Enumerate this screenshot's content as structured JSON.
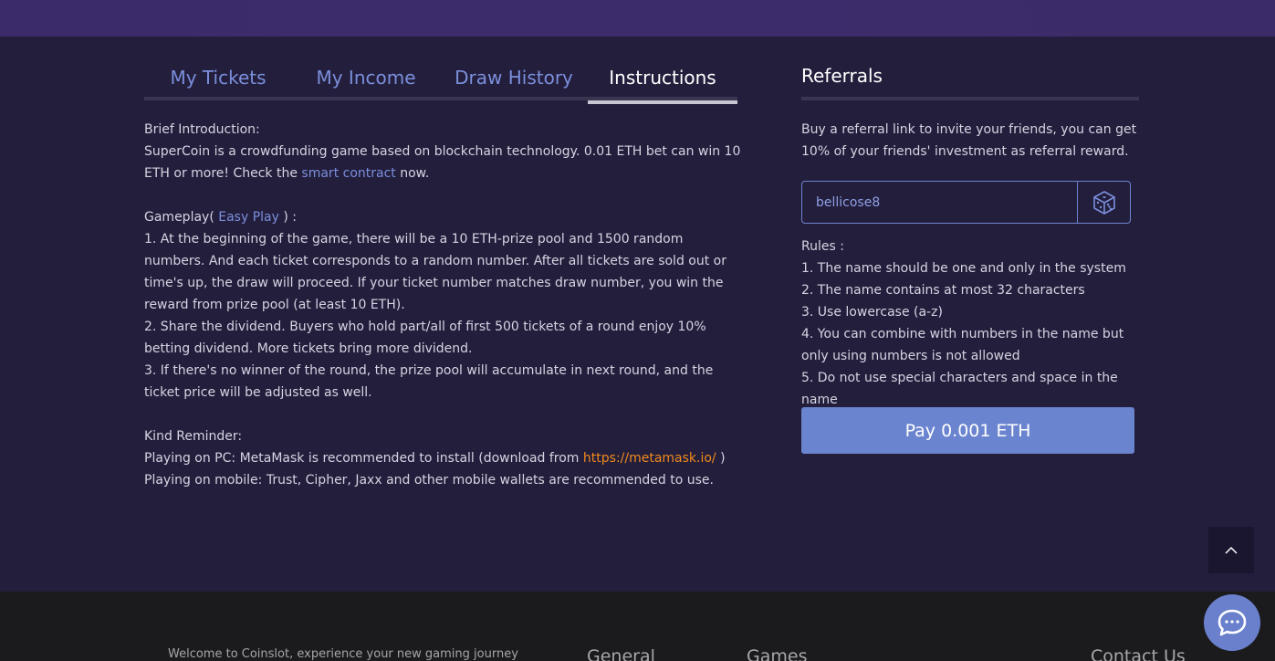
{
  "tabs": [
    {
      "label": "My Tickets"
    },
    {
      "label": "My Income"
    },
    {
      "label": "Draw History"
    },
    {
      "label": "Instructions"
    }
  ],
  "instructions": {
    "brief_heading": "Brief Introduction:",
    "brief_text_1": "SuperCoin is a crowdfunding game based on blockchain technology. 0.01 ETH bet can win 10 ETH or more! Check the ",
    "smart_contract_link": "smart contract",
    "brief_text_2": " now.",
    "gameplay_prefix": "Gameplay( ",
    "easy_play_link": "Easy Play",
    "gameplay_suffix": " ) :",
    "rule_1": "1. At the beginning of the game, there will be a 10 ETH-prize pool and 1500 random numbers. And each ticket corresponds to a random number. After all tickets are sold out or time's up, the draw will proceed. If your ticket number matches draw number, you win the reward from prize pool (at least 10 ETH).",
    "rule_2": "2. Share the dividend. Buyers who hold part/all of first 500 tickets of a round enjoy 10% betting dividend. More tickets bring more dividend.",
    "rule_3": "3. If there's no winner of the round, the prize pool will accumulate in next round, and the ticket price will be adjusted as well.",
    "reminder_heading": "Kind Reminder:",
    "pc_text_1": "Playing on PC: MetaMask is recommended to install (download from ",
    "metamask_link": "https://metamask.io/",
    "pc_text_2": " )",
    "mobile_text": "Playing on mobile: Trust, Cipher, Jaxx and other mobile wallets are recommended to use."
  },
  "referrals": {
    "title": "Referrals",
    "description": "Buy a referral link to invite your friends, you can get 10% of your friends' investment as referral reward.",
    "input_value": "bellicose8",
    "rules_heading": "Rules :",
    "rules": [
      "1. The name should be one and only in the system",
      "2. The name contains at most 32 characters",
      "3. Use lowercase (a-z)",
      "4. You can combine with numbers in the name but only using numbers is not allowed",
      "5. Do not use special characters and space in the name"
    ],
    "pay_label": "Pay 0.001 ETH"
  },
  "footer": {
    "welcome": "Welcome to Coinslot, experience your new gaming journey",
    "general": "General",
    "games": "Games",
    "contact": "Contact Us"
  },
  "icons": {
    "dice": "dice-icon",
    "back_to_top": "chevron-up-icon",
    "chat": "chat-icon"
  },
  "colors": {
    "accent_blue": "#7b8fdc",
    "link_orange": "#f08a1d",
    "button_blue": "#6b84cf"
  }
}
